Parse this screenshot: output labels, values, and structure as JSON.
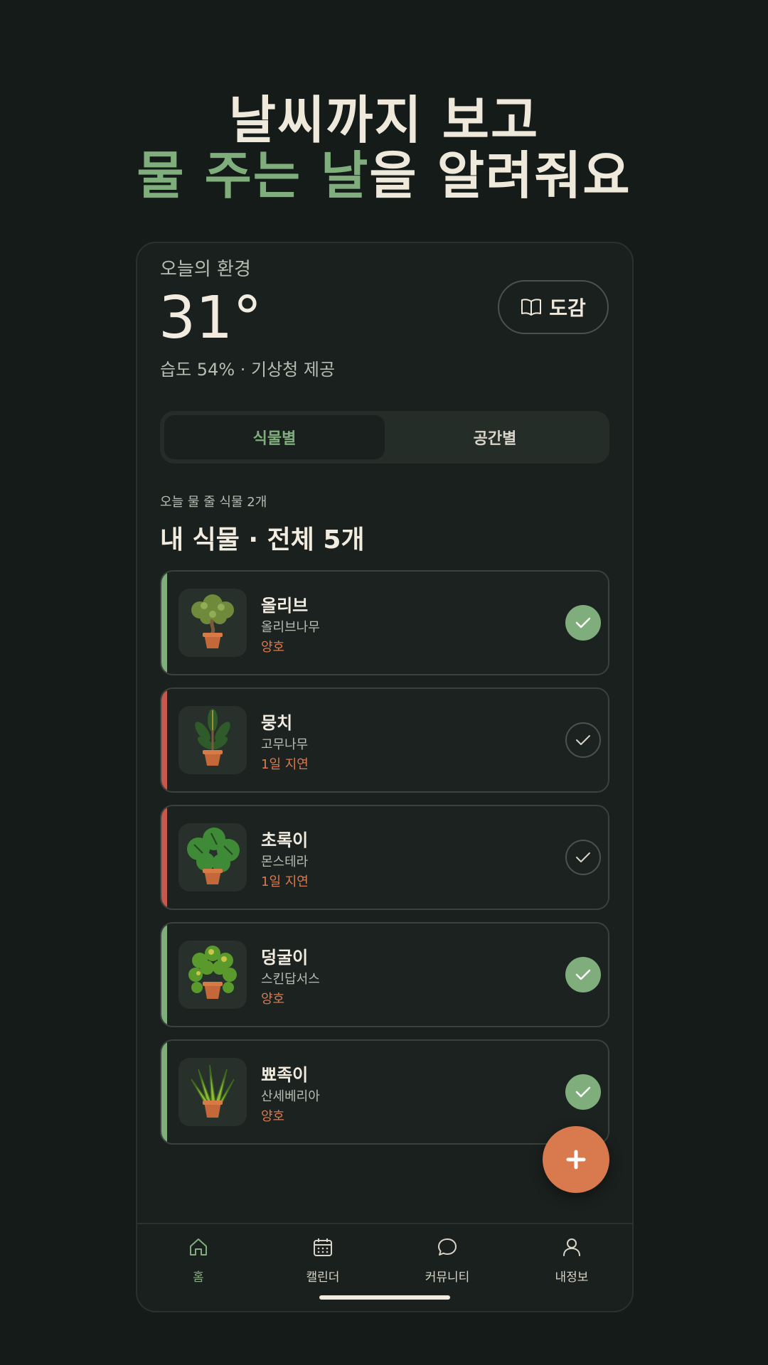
{
  "headline": {
    "line1": "날씨까지 보고",
    "line2_accent": "물 주는 날",
    "line2_rest": "을 알려줘요"
  },
  "environment": {
    "label": "오늘의 환경",
    "temperature": "31°",
    "humidity_source": "습도 54% · 기상청 제공"
  },
  "guide_button": {
    "label": "도감",
    "icon": "book-icon"
  },
  "segment": {
    "tabs": [
      {
        "label": "식물별",
        "active": true
      },
      {
        "label": "공간별",
        "active": false
      }
    ]
  },
  "today_water": "오늘 물 줄 식물 2개",
  "list_title": "내 식물 · 전체 5개",
  "colors": {
    "accent_green": "#7fae7c",
    "warning_red": "#c9584c",
    "fab_orange": "#d9794e"
  },
  "plants": [
    {
      "name": "올리브",
      "species": "올리브나무",
      "status": "양호",
      "watered": true,
      "state": "ok",
      "image": "olive-tree-in-pot"
    },
    {
      "name": "뭉치",
      "species": "고무나무",
      "status": "1일 지연",
      "watered": false,
      "state": "late",
      "image": "rubber-plant-in-pot"
    },
    {
      "name": "초록이",
      "species": "몬스테라",
      "status": "1일 지연",
      "watered": false,
      "state": "late",
      "image": "monstera-in-pot"
    },
    {
      "name": "덩굴이",
      "species": "스킨답서스",
      "status": "양호",
      "watered": true,
      "state": "ok",
      "image": "pothos-in-pot"
    },
    {
      "name": "뾰족이",
      "species": "산세베리아",
      "status": "양호",
      "watered": true,
      "state": "ok",
      "image": "sansevieria-in-pot"
    }
  ],
  "fab": {
    "label": "+",
    "icon": "plus-icon"
  },
  "nav": [
    {
      "label": "홈",
      "icon": "home-icon",
      "active": true
    },
    {
      "label": "캘린더",
      "icon": "calendar-icon",
      "active": false
    },
    {
      "label": "커뮤니티",
      "icon": "chat-bubble-icon",
      "active": false
    },
    {
      "label": "내정보",
      "icon": "user-icon",
      "active": false
    }
  ]
}
